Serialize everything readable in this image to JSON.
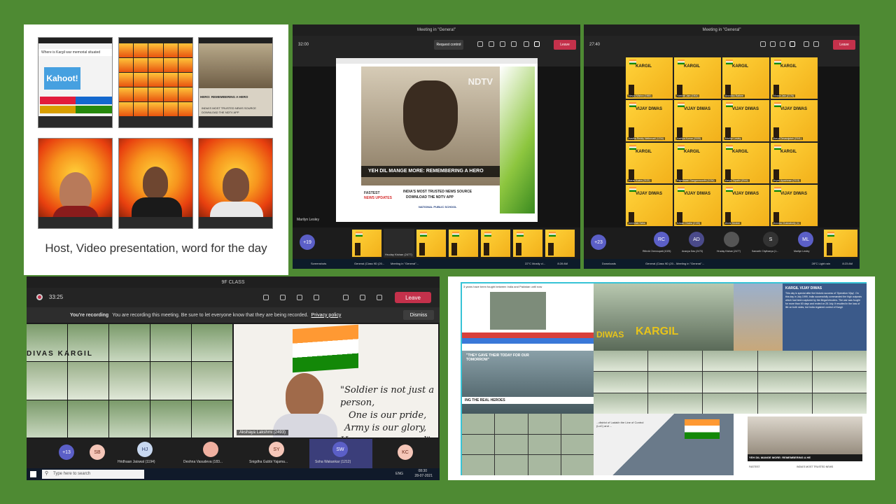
{
  "panel1": {
    "caption": "Host, Video presentation, word for the day",
    "kahoot_question": "Where is Kargil war memorial situated",
    "kahoot_logo": "Kahoot!",
    "kahoot_answers": [
      "Jammu & Kashmir",
      "Ladakh",
      "Himachal",
      "Uttarakhand"
    ],
    "news_line1": "HERO: REMEMBERING A HERO",
    "news_line2": "INDIA'S MOST TRUSTED NEWS SOURCE",
    "news_line3": "DOWNLOAD THE NDTV APP"
  },
  "panel2": {
    "window_title": "Meeting in \"General\"",
    "timer": "32:00",
    "request_control": "Request control",
    "leave": "Leave",
    "video_headline": "YEH DIL MANGE MORE: REMEMBERING A HERO",
    "watermark": "NDTV",
    "fastest": "FASTEST",
    "news_updates": "NEWS UPDATES",
    "trusted": "INDIA'S MOST TRUSTED NEWS SOURCE",
    "download": "DOWNLOAD THE NDTV APP",
    "school": "NATIONAL PUBLIC SCHOOL",
    "presenter": "Marilyn Lesley",
    "participants": [
      {
        "name": "Hruday Kishan (2477)"
      }
    ],
    "overflow": "+19",
    "weather": "22°C Mostly cl...",
    "clock": "8:28 AM",
    "taskbar_items": [
      "Screenshots",
      "General (Class 9D (20...",
      "Meeting in \"General\"..."
    ]
  },
  "panel3": {
    "window_title": "Meeting in \"General\"",
    "timer": "27:40",
    "leave": "Leave",
    "banner_title": "KARGIL",
    "banner_sub": "VIJAY DIWAS",
    "names_row1": [
      "Navya Mishra (1965)",
      "Vaishali Jain (1904)",
      "Anushka Rathee",
      "Vivaan Jain (2176)"
    ],
    "names_row2": [
      "Aastha Reddy Nettemadi (1234)",
      "Aaditya Kumar (2005)",
      "Marilyn Lesley",
      "Aarya Devarajaiah (2341)"
    ],
    "names_row3": [
      "Aarav Kudra (2122)",
      "Rajeshwari Ganganmoorthi (1034)",
      "Aarya Tripathi (2044)",
      "Aryan Ayushman (2113)",
      "Ayti Giri (2333)"
    ],
    "names_row4": [
      "Abhishek Saha",
      "Ishaan Chatra (2135)",
      "Rithvik Chennupati (1025)",
      "Aishe Monish",
      "Anusha Chakraborty (1)"
    ],
    "participants": [
      {
        "initials": "RC",
        "name": "Rithvik Chennupati (1025)",
        "color": "#5b5fc7"
      },
      {
        "initials": "AD",
        "name": "Ananya Das (2473)",
        "color": "#4a4a8a"
      },
      {
        "initials": "",
        "name": "Hruday Kishan (2477)",
        "color": "#555"
      },
      {
        "initials": "S",
        "name": "Samarth Chythanya (1...",
        "color": "#333"
      },
      {
        "initials": "ML",
        "name": "Marilyn Lesley",
        "color": "#5b5fc7"
      }
    ],
    "overflow": "+23",
    "weather": "28°C Light rain",
    "clock": "8:23 AM",
    "taskbar_items": [
      "Downloads",
      "General (Class 9D (20...",
      "Meeting in \"General\"..."
    ]
  },
  "panel4": {
    "window_title": "9F CLASS",
    "timer": "33:25",
    "leave": "Leave",
    "recording_label": "You're recording",
    "recording_text": "You are recording this meeting. Be sure to let everyone know that they are being recorded.",
    "privacy_link": "Privacy policy",
    "dismiss": "Dismiss",
    "quote_line1": "\"Soldier is not just a person,",
    "quote_line2": "One is our pride,",
    "quote_line3": "Army is our glory,",
    "quote_line4": "Honour we earned\"",
    "speaker": "Akshaya Lakshmi (2493)",
    "grid_banner": "DIVAS KARGIL",
    "participants": [
      {
        "initials": "+13",
        "name": "",
        "color": "#5b5fc7"
      },
      {
        "initials": "SB",
        "name": "",
        "color": "#f5c6b8"
      },
      {
        "initials": "HJ",
        "name": "Hridhaan Jaiswal (1194)",
        "color": "#c8d8f0"
      },
      {
        "initials": "",
        "name": "Deshna Vasudeva (183...",
        "color": "#f0b0a0"
      },
      {
        "initials": "SY",
        "name": "Snigdha Gubbi Yajama...",
        "color": "#f5c6b8"
      },
      {
        "initials": "SW",
        "name": "Soha Wakankar (1212)",
        "color": "#5b5fc7"
      },
      {
        "initials": "KC",
        "name": "",
        "color": "#f5c6b8"
      }
    ],
    "search_placeholder": "Type here to search",
    "clock": "08:30",
    "date": "28-07-2021",
    "language": "ENG"
  },
  "panel5": {
    "top_text": "3 years have been fought between India and Pakistan until now",
    "kargil_text": "KARGIL",
    "vijay": "DIWAS",
    "divas": "DIVAS",
    "gave_their_today": "\"THEY GAVE THEIR TODAY FOR OUR TOMORROW\"",
    "real_heroes": "ING THE REAL HEROES",
    "ndtv_line": "YEH DIL MANGE MORE: REMEMBERING A HE",
    "fastest": "FASTEST",
    "trusted": "INDIA'S MOST TRUSTED NEWS",
    "vijay_diwas_title": "KARGIL VIJAY DIWAS",
    "paragraph": "This day is special after the historic success of 'Operation Vijay'. On this day in July 1999, India successfully commanded the high outposts which had been captured by the illegal intruders. The war was fought for more than 60 days and ended on 26 July. It resulted in the loss of life on both sides, but India regained control of Kargil.",
    "ladakh_text": "...district of Ladakh the Line of Control (LoC) and ..."
  },
  "icons": {
    "mic": "mic-icon",
    "camera": "camera-icon",
    "share": "share-icon",
    "chat": "chat-icon",
    "people": "people-icon",
    "more": "more-icon",
    "hand": "raise-hand-icon",
    "record": "record-icon",
    "windows": "windows-icon",
    "search": "search-icon"
  },
  "colors": {
    "background": "#4e8a33",
    "teams_red": "#c4314b",
    "teams_purple": "#5b5fc7",
    "kargil_yellow": "#f7c52b"
  }
}
